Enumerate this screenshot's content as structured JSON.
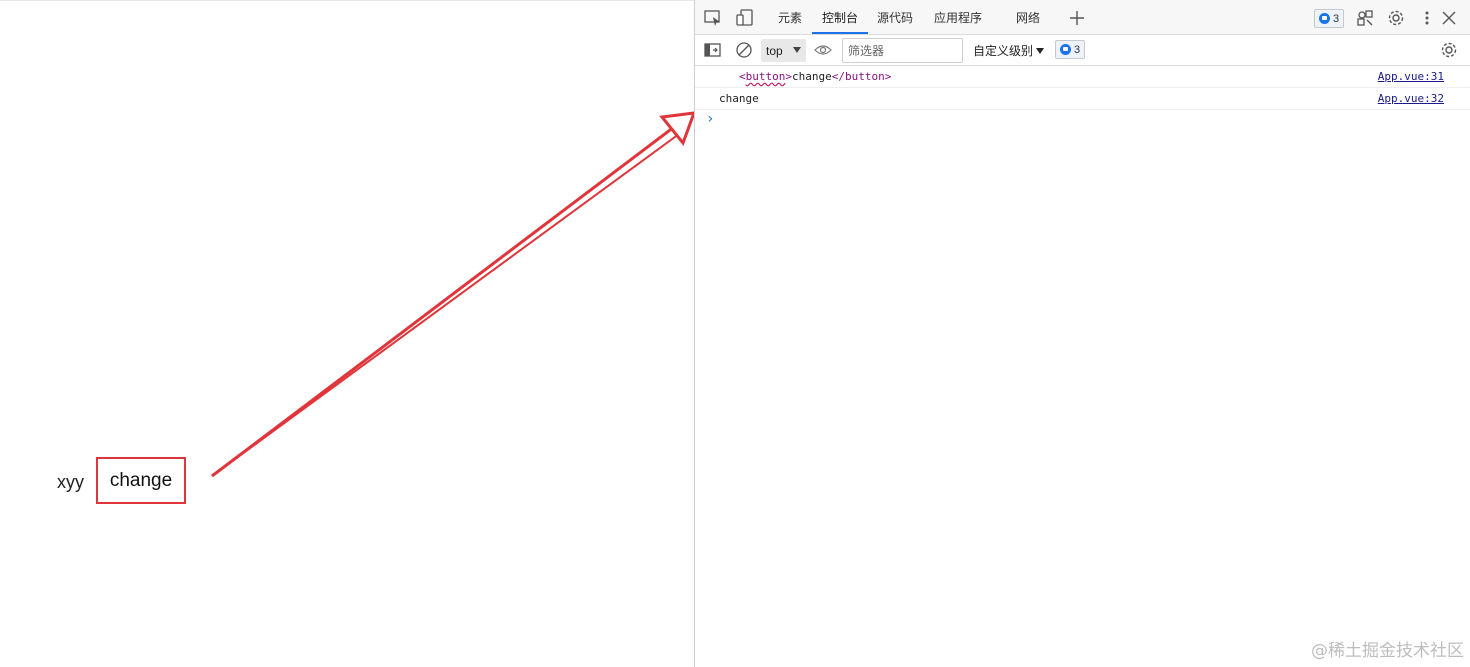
{
  "page": {
    "label_text": "xyy",
    "button_label": "change"
  },
  "devtools": {
    "tabs": [
      {
        "label": "元素"
      },
      {
        "label": "控制台"
      },
      {
        "label": "源代码"
      },
      {
        "label": "应用程序"
      },
      {
        "label": "网络"
      }
    ],
    "active_tab": "控制台",
    "issues_count": "3",
    "toolbar": {
      "context": "top",
      "filter_placeholder": "筛选器",
      "level": "自定义级别",
      "issues_count": "3"
    },
    "console": {
      "rows": [
        {
          "open_tag": "<",
          "tag_name": "button",
          "close_open": ">",
          "text": "change",
          "end_tag": "</button>",
          "source": "App.vue:31"
        },
        {
          "text": "change",
          "source": "App.vue:32"
        }
      ],
      "prompt": "›"
    }
  },
  "annotation_color": "#e0353b",
  "watermark": "@稀土掘金技术社区"
}
